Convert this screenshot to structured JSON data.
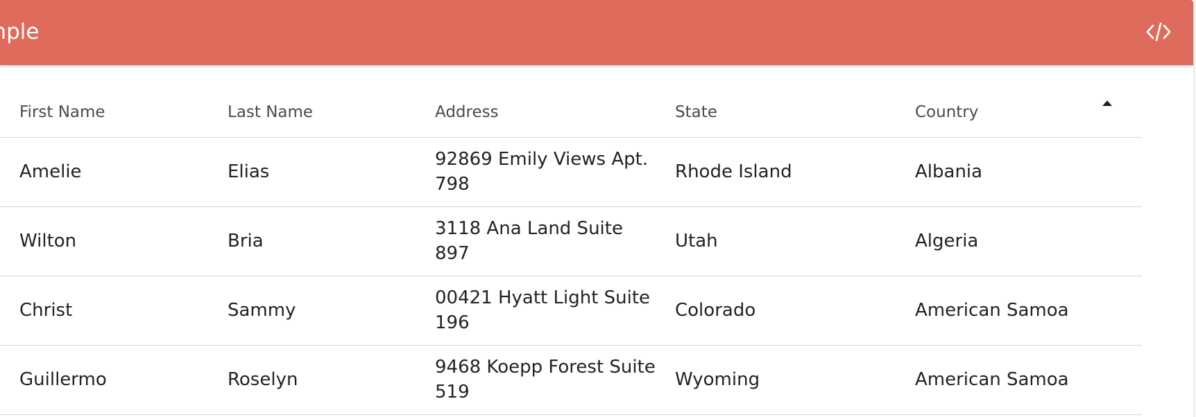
{
  "header": {
    "title": "Example",
    "code_toggle_icon": "code-icon",
    "color": "#df6b5c"
  },
  "table": {
    "columns": [
      {
        "label": "First Name"
      },
      {
        "label": "Last Name"
      },
      {
        "label": "Address"
      },
      {
        "label": "State"
      },
      {
        "label": "Country",
        "sort": "ascending",
        "sort_icon": "sort-ascending-icon"
      }
    ],
    "rows": [
      [
        "Amelie",
        "Elias",
        "92869 Emily Views Apt. 798",
        "Rhode Island",
        "Albania"
      ],
      [
        "Wilton",
        "Bria",
        "3118 Ana Land Suite 897",
        "Utah",
        "Algeria"
      ],
      [
        "Christ",
        "Sammy",
        "00421 Hyatt Light Suite 196",
        "Colorado",
        "American Samoa"
      ],
      [
        "Guillermo",
        "Roselyn",
        "9468 Koepp Forest Suite 519",
        "Wyoming",
        "American Samoa"
      ]
    ]
  }
}
